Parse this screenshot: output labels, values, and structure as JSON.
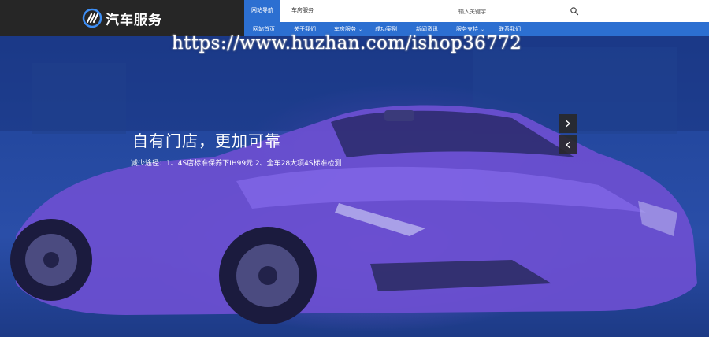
{
  "header": {
    "logo_text": "汽车服务",
    "top_tabs": [
      {
        "label": "网站导航",
        "active": true
      },
      {
        "label": "车房服务",
        "active": false
      }
    ],
    "search": {
      "placeholder": "输入关键字...",
      "icon": "search-icon"
    },
    "nav": [
      {
        "label": "网站首页",
        "has_dropdown": false
      },
      {
        "label": "关于我们",
        "has_dropdown": false
      },
      {
        "label": "车房服务",
        "has_dropdown": true
      },
      {
        "label": "成功案例",
        "has_dropdown": false
      },
      {
        "label": "新闻资讯",
        "has_dropdown": false
      },
      {
        "label": "服务支持",
        "has_dropdown": true
      },
      {
        "label": "联系我们",
        "has_dropdown": false
      }
    ]
  },
  "watermark": "https://www.huzhan.com/ishop36772",
  "slide": {
    "title": "自有门店，更加可靠",
    "description": "减少途径：1、4S店标准保养下IH99元 2、全车28大项4S标准检测"
  },
  "slider_controls": {
    "next_icon": "chevron-right-icon",
    "prev_icon": "chevron-left-icon"
  },
  "colors": {
    "nav_blue": "#2c6fd1",
    "logo_bg": "#262626",
    "hero_blue": "#1c3f9a",
    "car_purple": "#6a4fd0"
  }
}
